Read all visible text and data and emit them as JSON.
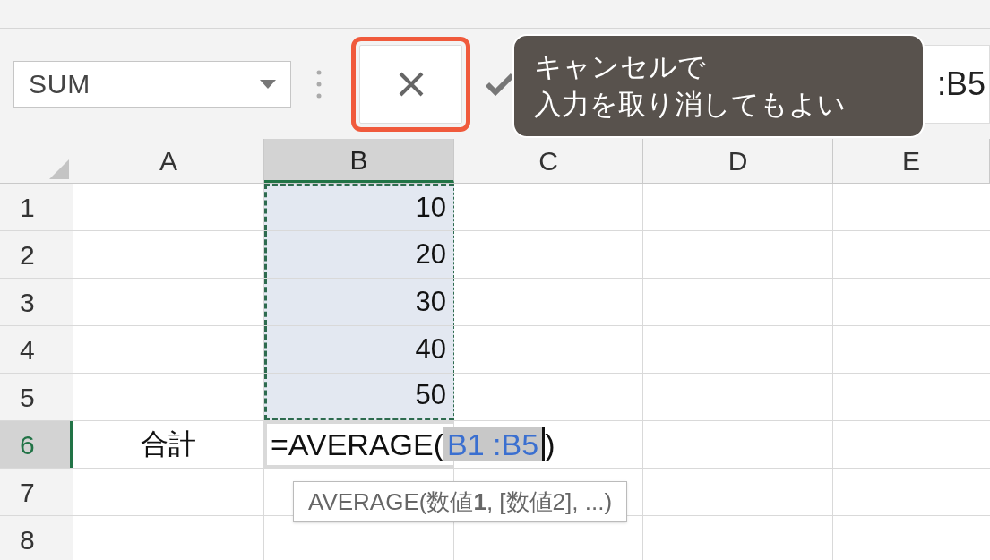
{
  "name_box": {
    "value": "SUM"
  },
  "formula_bar": {
    "cancel_highlighted": true,
    "formula": ":B5"
  },
  "callout": {
    "lines": [
      "キャンセルで",
      "入力を取り消してもよい"
    ]
  },
  "columns": [
    {
      "label": "A",
      "selected": false
    },
    {
      "label": "B",
      "selected": true
    },
    {
      "label": "C",
      "selected": false
    },
    {
      "label": "D",
      "selected": false
    },
    {
      "label": "E",
      "selected": false
    }
  ],
  "rows": [
    {
      "label": "1",
      "selected": false,
      "b": "10",
      "in_range": true
    },
    {
      "label": "2",
      "selected": false,
      "b": "20",
      "in_range": true
    },
    {
      "label": "3",
      "selected": false,
      "b": "30",
      "in_range": true
    },
    {
      "label": "4",
      "selected": false,
      "b": "40",
      "in_range": true
    },
    {
      "label": "5",
      "selected": false,
      "b": "50",
      "in_range": true
    },
    {
      "label": "6",
      "selected": true,
      "a": "合計",
      "in_range": false,
      "editing": {
        "before": "=AVERAGE(",
        "ref": "B1 :B5",
        "after": ")"
      }
    },
    {
      "label": "7",
      "selected": false,
      "in_range": false
    },
    {
      "label": "8",
      "selected": false,
      "in_range": false
    }
  ],
  "autocomplete": {
    "hint": "AVERAGE(数値**1**, [数値2], ...)"
  }
}
